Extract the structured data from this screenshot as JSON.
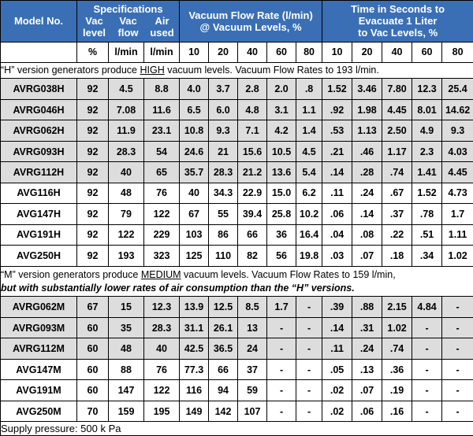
{
  "header": {
    "model_label": "Model No.",
    "specifications_label": "Specifications",
    "spec_sub": [
      "Vac level",
      "Vac flow",
      "Air used"
    ],
    "spec_sub_line1": [
      "Vac",
      "Vac",
      "Air"
    ],
    "spec_sub_line2": [
      "level",
      "flow",
      "used"
    ],
    "flow_title_line1": "Vacuum Flow Rate (l/min)",
    "flow_title_line2": "@ Vacuum Levels, %",
    "time_title_line1": "Time in Seconds to",
    "time_title_line2": "Evacuate 1 Liter",
    "time_title_line3": "to Vac Levels, %",
    "units": [
      "%",
      "l/min",
      "l/min"
    ],
    "flow_levels": [
      "10",
      "20",
      "40",
      "60",
      "80"
    ],
    "time_levels": [
      "10",
      "20",
      "40",
      "60",
      "80"
    ]
  },
  "notes": {
    "h_note_pre": "“H” version generators produce ",
    "h_note_underline": "HIGH",
    "h_note_post": " vacuum levels. Vacuum Flow Rates to 193 l/min.",
    "m_note_pre": "“M” version generators produce ",
    "m_note_underline": "MEDIUM",
    "m_note_post": " vacuum levels. Vacuum Flow Rates to 159 l/min,",
    "m_note_line2": "but with substantially lower rates of air consumption than the “H” versions."
  },
  "rows_h": [
    {
      "model": "AVRG038H",
      "shaded": true,
      "vac_level": "92",
      "vac_flow": "4.5",
      "air_used": "8.8",
      "flow": [
        "4.0",
        "3.7",
        "2.8",
        "2.0",
        ".8"
      ],
      "time": [
        "1.52",
        "3.46",
        "7.80",
        "12.3",
        "25.4"
      ]
    },
    {
      "model": "AVRG046H",
      "shaded": true,
      "vac_level": "92",
      "vac_flow": "7.08",
      "air_used": "11.6",
      "flow": [
        "6.5",
        "6.0",
        "4.8",
        "3.1",
        "1.1"
      ],
      "time": [
        ".92",
        "1.98",
        "4.45",
        "8.01",
        "14.62"
      ]
    },
    {
      "model": "AVRG062H",
      "shaded": true,
      "vac_level": "92",
      "vac_flow": "11.9",
      "air_used": "23.1",
      "flow": [
        "10.8",
        "9.3",
        "7.1",
        "4.2",
        "1.4"
      ],
      "time": [
        ".53",
        "1.13",
        "2.50",
        "4.9",
        "9.3"
      ]
    },
    {
      "model": "AVRG093H",
      "shaded": true,
      "vac_level": "92",
      "vac_flow": "28.3",
      "air_used": "54",
      "flow": [
        "24.6",
        "21",
        "15.6",
        "10.5",
        "4.5"
      ],
      "time": [
        ".21",
        ".46",
        "1.17",
        "2.3",
        "4.03"
      ]
    },
    {
      "model": "AVRG112H",
      "shaded": true,
      "vac_level": "92",
      "vac_flow": "40",
      "air_used": "65",
      "flow": [
        "35.7",
        "28.3",
        "21.2",
        "13.6",
        "5.4"
      ],
      "time": [
        ".14",
        ".28",
        ".74",
        "1.41",
        "4.45"
      ]
    },
    {
      "model": "AVG116H",
      "shaded": false,
      "vac_level": "92",
      "vac_flow": "48",
      "air_used": "76",
      "flow": [
        "40",
        "34.3",
        "22.9",
        "15.0",
        "6.2"
      ],
      "time": [
        ".11",
        ".24",
        ".67",
        "1.52",
        "4.73"
      ]
    },
    {
      "model": "AVG147H",
      "shaded": false,
      "vac_level": "92",
      "vac_flow": "79",
      "air_used": "122",
      "flow": [
        "67",
        "55",
        "39.4",
        "25.8",
        "10.2"
      ],
      "time": [
        ".06",
        ".14",
        ".37",
        ".78",
        "1.7"
      ]
    },
    {
      "model": "AVG191H",
      "shaded": false,
      "vac_level": "92",
      "vac_flow": "122",
      "air_used": "229",
      "flow": [
        "103",
        "86",
        "66",
        "36",
        "16.4"
      ],
      "time": [
        ".04",
        ".08",
        ".22",
        ".51",
        "1.11"
      ]
    },
    {
      "model": "AVG250H",
      "shaded": false,
      "vac_level": "92",
      "vac_flow": "193",
      "air_used": "323",
      "flow": [
        "125",
        "110",
        "82",
        "56",
        "19.8"
      ],
      "time": [
        ".03",
        ".07",
        ".18",
        ".34",
        "1.02"
      ]
    }
  ],
  "rows_m": [
    {
      "model": "AVRG062M",
      "shaded": true,
      "vac_level": "67",
      "vac_flow": "15",
      "air_used": "12.3",
      "flow": [
        "13.9",
        "12.5",
        "8.5",
        "1.7",
        "-"
      ],
      "time": [
        ".39",
        ".88",
        "2.15",
        "4.84",
        "-"
      ]
    },
    {
      "model": "AVRG093M",
      "shaded": true,
      "vac_level": "60",
      "vac_flow": "35",
      "air_used": "28.3",
      "flow": [
        "31.1",
        "26.1",
        "13",
        "-",
        "-"
      ],
      "time": [
        ".14",
        ".31",
        "1.02",
        "-",
        "-"
      ]
    },
    {
      "model": "AVRG112M",
      "shaded": true,
      "vac_level": "60",
      "vac_flow": "48",
      "air_used": "40",
      "flow": [
        "42.5",
        "36.5",
        "24",
        "-",
        "-"
      ],
      "time": [
        ".11",
        ".24",
        ".74",
        "-",
        "-"
      ]
    },
    {
      "model": "AVG147M",
      "shaded": false,
      "vac_level": "60",
      "vac_flow": "88",
      "air_used": "76",
      "flow": [
        "77.3",
        "66",
        "37",
        "-",
        "-"
      ],
      "time": [
        ".05",
        ".13",
        ".36",
        "-",
        "-"
      ]
    },
    {
      "model": "AVG191M",
      "shaded": false,
      "vac_level": "60",
      "vac_flow": "147",
      "air_used": "122",
      "flow": [
        "116",
        "94",
        "59",
        "-",
        "-"
      ],
      "time": [
        ".02",
        ".07",
        ".19",
        "-",
        "-"
      ]
    },
    {
      "model": "AVG250M",
      "shaded": false,
      "vac_level": "70",
      "vac_flow": "159",
      "air_used": "195",
      "flow": [
        "149",
        "142",
        "107",
        "-",
        "-"
      ],
      "time": [
        ".02",
        ".06",
        ".16",
        "-",
        "-"
      ]
    }
  ],
  "footer": {
    "supply_pressure": "Supply pressure: 500 k Pa"
  },
  "colors": {
    "header_blue": "#3a6fb5",
    "row_shade": "#dddddd",
    "border": "#000000"
  }
}
